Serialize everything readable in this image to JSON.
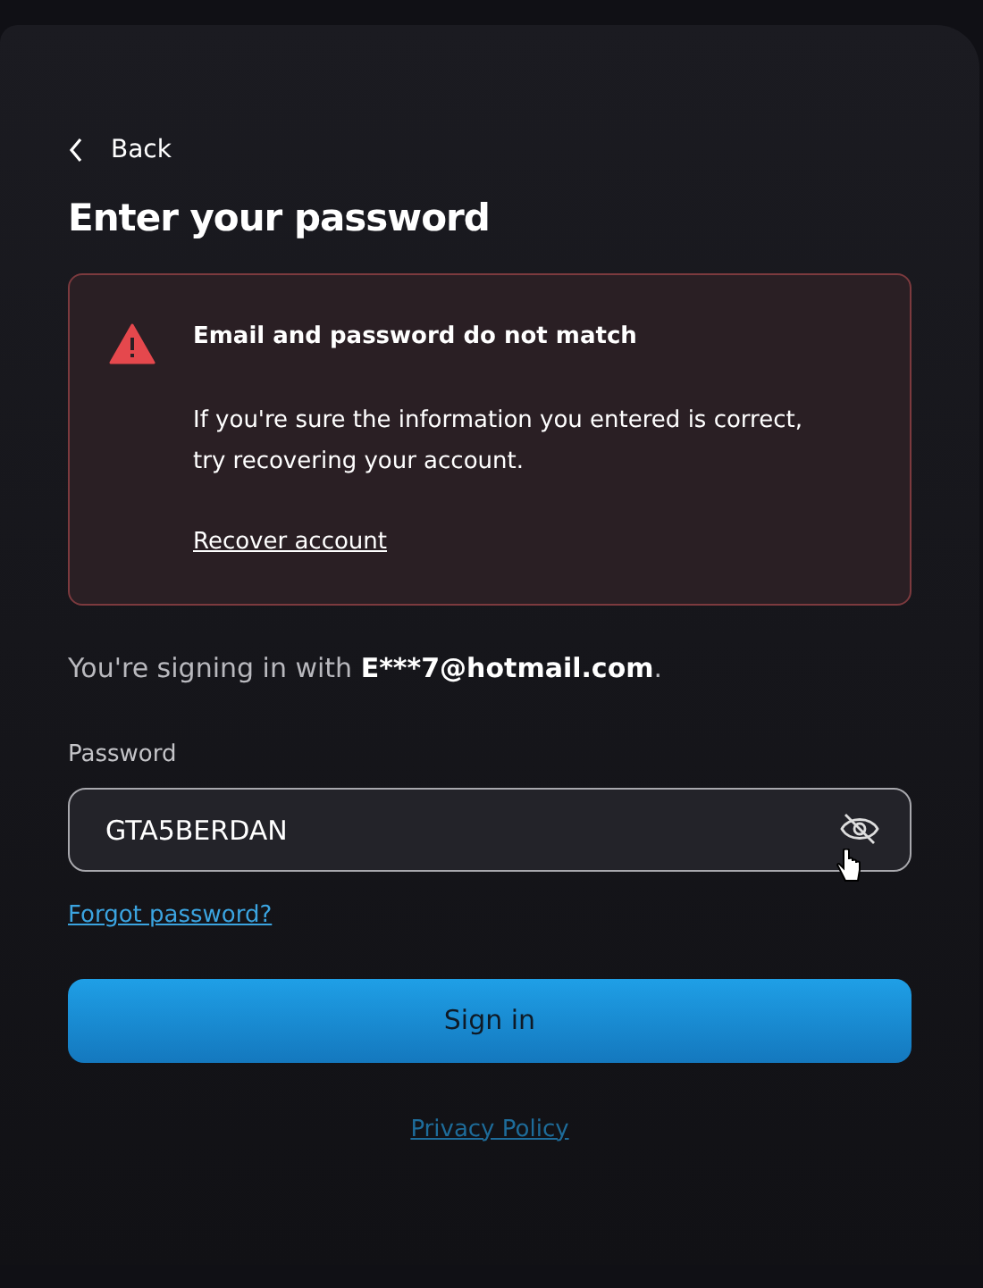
{
  "back": {
    "label": "Back"
  },
  "title": "Enter your password",
  "alert": {
    "title": "Email and password do not match",
    "message": "If you're sure the information you entered is correct, try recovering your account.",
    "link": "Recover account"
  },
  "signing_in": {
    "prefix": "You're signing in with ",
    "email": "E***7@hotmail.com",
    "suffix": "."
  },
  "password": {
    "label": "Password",
    "value": "GTA5BERDAN"
  },
  "forgot_link": "Forgot password?",
  "submit": "Sign in",
  "footer_link": "Privacy Policy"
}
